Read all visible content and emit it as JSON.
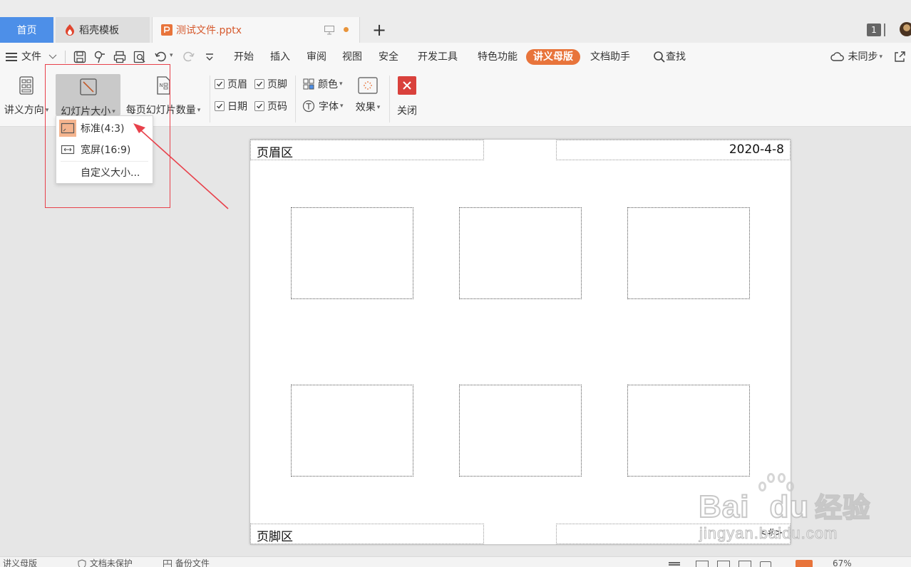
{
  "tabs": {
    "home": "首页",
    "daoke": "稻壳模板",
    "file": "测试文件.pptx",
    "add": "+",
    "badge": "1"
  },
  "menu": {
    "file": "文件",
    "tabs": [
      "开始",
      "插入",
      "审阅",
      "视图",
      "安全",
      "开发工具",
      "特色功能",
      "讲义母版",
      "文档助手"
    ],
    "search": "查找",
    "sync": "未同步"
  },
  "ribbon": {
    "orientation": "讲义方向",
    "slide_size": "幻灯片大小",
    "per_page": "每页幻灯片数量",
    "header": "页眉",
    "footer": "页脚",
    "date": "日期",
    "page_num": "页码",
    "color": "颜色",
    "font": "字体",
    "effect": "效果",
    "close": "关闭"
  },
  "dropdown": {
    "standard": "标准(4:3)",
    "wide": "宽屏(16:9)",
    "custom": "自定义大小..."
  },
  "page": {
    "header_area": "页眉区",
    "date_value": "2020-4-8",
    "footer_area": "页脚区",
    "page_num_token": "<#>"
  },
  "status": {
    "left1": "讲义母版",
    "left2": "文档未保护",
    "left3": "备份文件",
    "zoom": "67%"
  },
  "watermark": {
    "text1": "Bai",
    "text2": "du",
    "text3": "经验",
    "url": "jingyan.baidu.com"
  },
  "colors": {
    "accent": "#e8743b",
    "home_tab": "#4d8fe8",
    "highlight": "#e8414b",
    "close_btn": "#d9413c"
  }
}
